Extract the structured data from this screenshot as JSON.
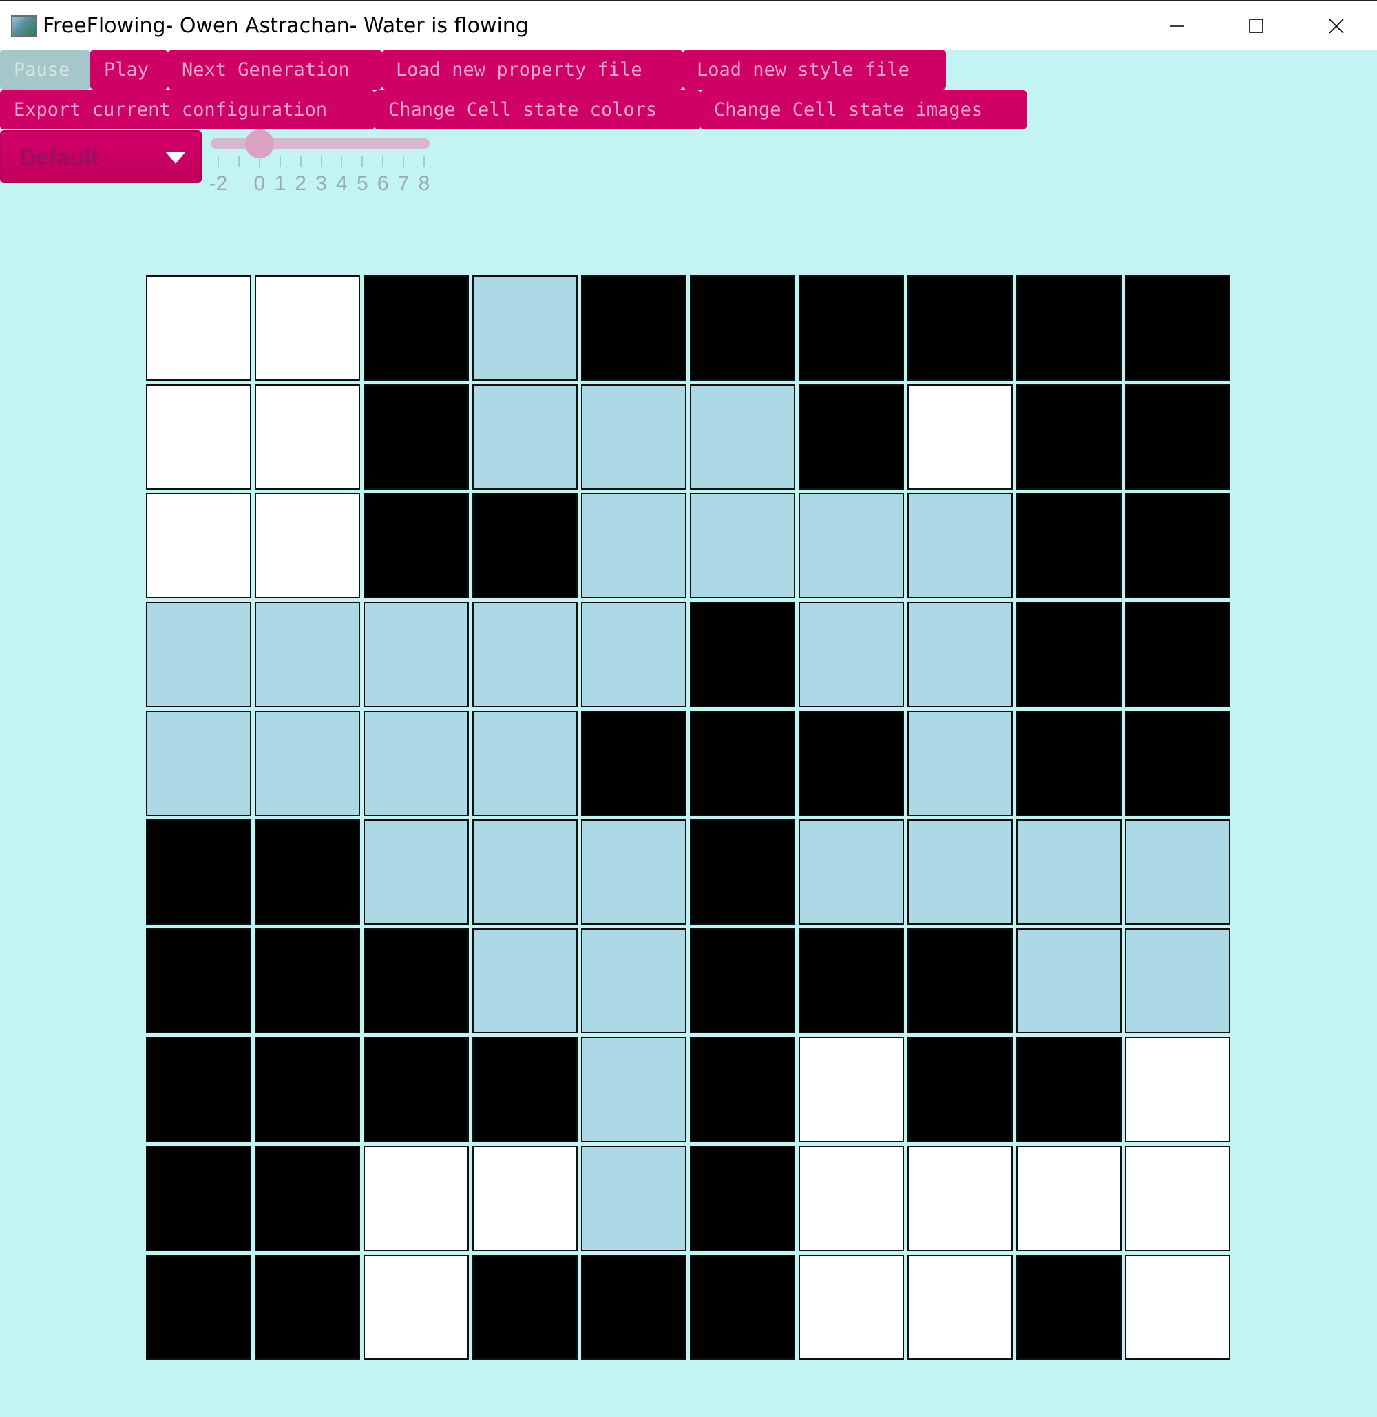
{
  "window": {
    "title": "FreeFlowing- Owen Astrachan- Water is flowing"
  },
  "toolbar": {
    "row1": [
      {
        "label": "Pause",
        "disabled": true
      },
      {
        "label": "Play",
        "disabled": false
      },
      {
        "label": "Next Generation",
        "disabled": false
      },
      {
        "label": "Load new property file",
        "disabled": false
      },
      {
        "label": "Load new style file",
        "disabled": false
      }
    ],
    "row2": [
      {
        "label": "Export current configuration",
        "disabled": false
      },
      {
        "label": "Change Cell state colors",
        "disabled": false
      },
      {
        "label": "Change Cell state images",
        "disabled": false
      }
    ]
  },
  "dropdown": {
    "value": "Default"
  },
  "slider": {
    "tick_labels": [
      "-2",
      "0",
      "1",
      "2",
      "3",
      "4",
      "5",
      "6",
      "7",
      "8"
    ],
    "value": 0
  },
  "colors": {
    "background": "#c4f3f3",
    "button": "#cf0066",
    "button_text": "#f0a6c4",
    "button_disabled": "#a6c7c9",
    "state_colors": {
      "W": "#ffffff",
      "B": "#000000",
      "L": "#add8e6"
    }
  },
  "grid": {
    "rows": [
      "WWBLBBBBBB",
      "WWBLLLBWBB",
      "WWBBLLLLBB",
      "LLLLLBLLBB",
      "LLLLBBBLBB",
      "BBLLLBLLLL",
      "BBBLLBBBLL",
      "BBBBLBWBBW",
      "BBWWLBWWWW",
      "BBWBBBWWBW"
    ]
  }
}
